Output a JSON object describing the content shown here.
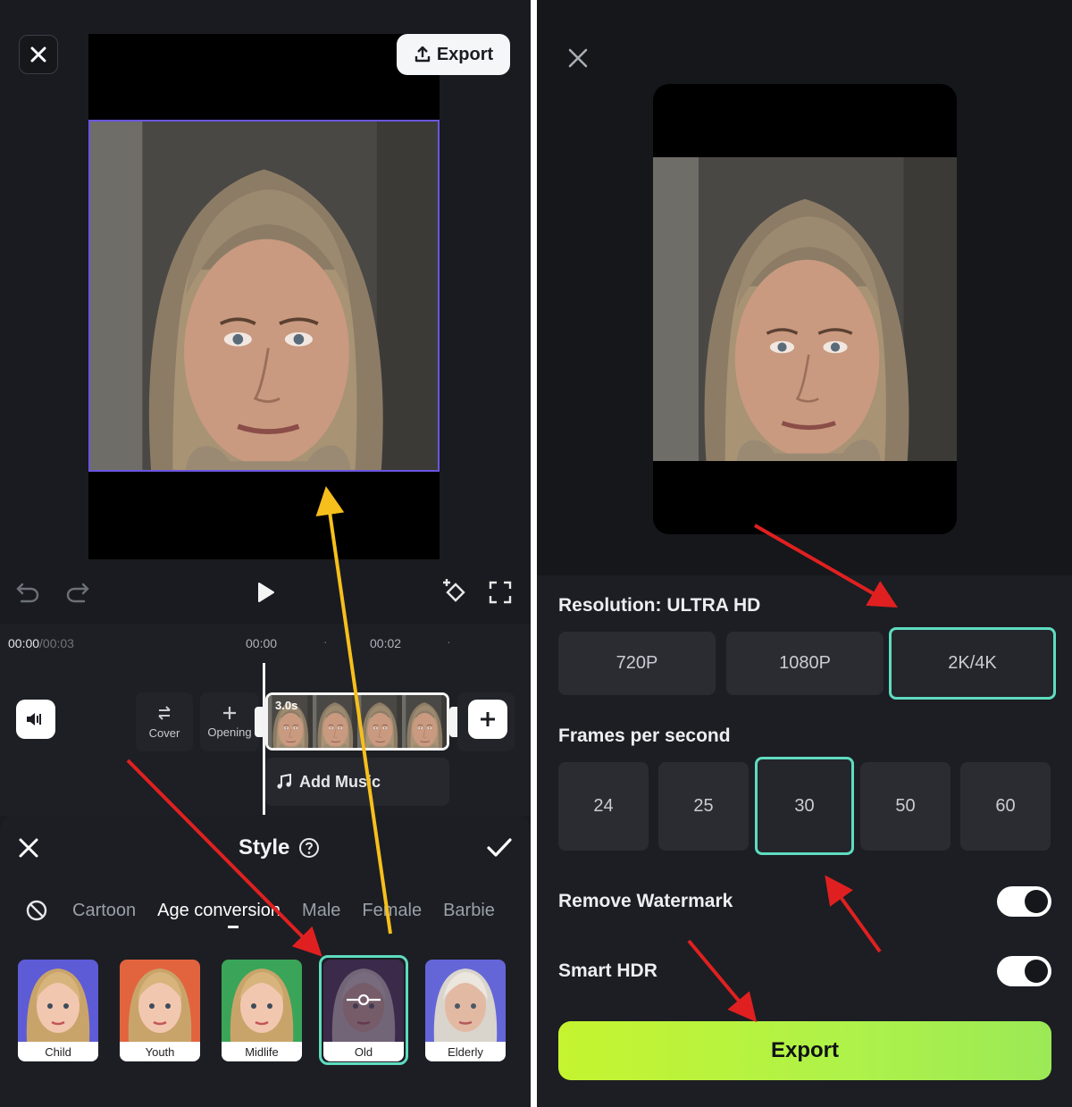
{
  "editor": {
    "export_label": "Export",
    "timecode_current": "00:00",
    "timecode_total": "/00:03",
    "ruler": [
      "00:00",
      "00:02"
    ],
    "cover_label": "Cover",
    "opening_label": "Opening",
    "clip_duration": "3.0s",
    "add_music_label": "Add Music"
  },
  "style_sheet": {
    "title": "Style",
    "tabs": [
      "Cartoon",
      "Age conversion",
      "Male",
      "Female",
      "Barbie"
    ],
    "active_tab": "Age conversion",
    "presets": [
      {
        "label": "Child",
        "bg": "#5d5bd6"
      },
      {
        "label": "Youth",
        "bg": "#e2643f"
      },
      {
        "label": "Midlife",
        "bg": "#3aa558"
      },
      {
        "label": "Old",
        "bg": "#3b2a4a"
      },
      {
        "label": "Elderly",
        "bg": "#6466d8"
      }
    ],
    "selected_preset": "Old"
  },
  "export_settings": {
    "resolution_label": "Resolution: ULTRA HD",
    "resolutions": [
      "720P",
      "1080P",
      "2K/4K"
    ],
    "selected_resolution": "2K/4K",
    "fps_label": "Frames per second",
    "fps_options": [
      "24",
      "25",
      "30",
      "50",
      "60"
    ],
    "selected_fps": "30",
    "remove_watermark_label": "Remove Watermark",
    "remove_watermark_on": true,
    "smart_hdr_label": "Smart HDR",
    "smart_hdr_on": true,
    "export_label": "Export"
  },
  "colors": {
    "accent_teal": "#5fdcc0",
    "export_green": "#c5f42f",
    "annotation_red": "#e02020",
    "annotation_yellow": "#f7bf1c",
    "selection_purple": "#6a55e0"
  }
}
